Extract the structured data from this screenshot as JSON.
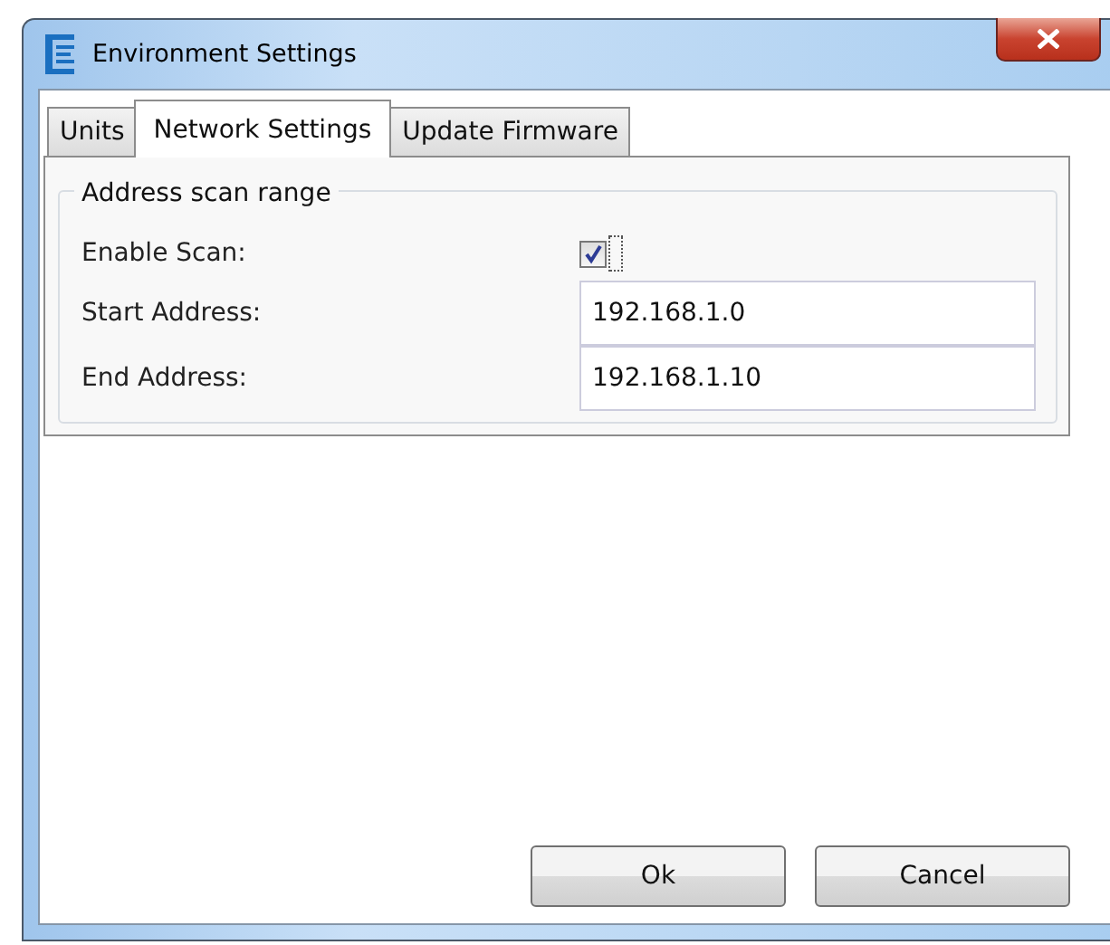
{
  "window": {
    "title": "Environment Settings"
  },
  "tabs": [
    {
      "label": "Units",
      "selected": false
    },
    {
      "label": "Network Settings",
      "selected": true
    },
    {
      "label": "Update Firmware",
      "selected": false
    }
  ],
  "group": {
    "title": "Address scan range",
    "fields": [
      {
        "kind": "checkbox",
        "label": "Enable Scan:",
        "checked": true
      },
      {
        "kind": "text",
        "label": "Start Address:",
        "value": "192.168.1.0"
      },
      {
        "kind": "text",
        "label": "End Address:",
        "value": "192.168.1.10"
      }
    ]
  },
  "buttons": [
    "Ok",
    "Cancel"
  ]
}
